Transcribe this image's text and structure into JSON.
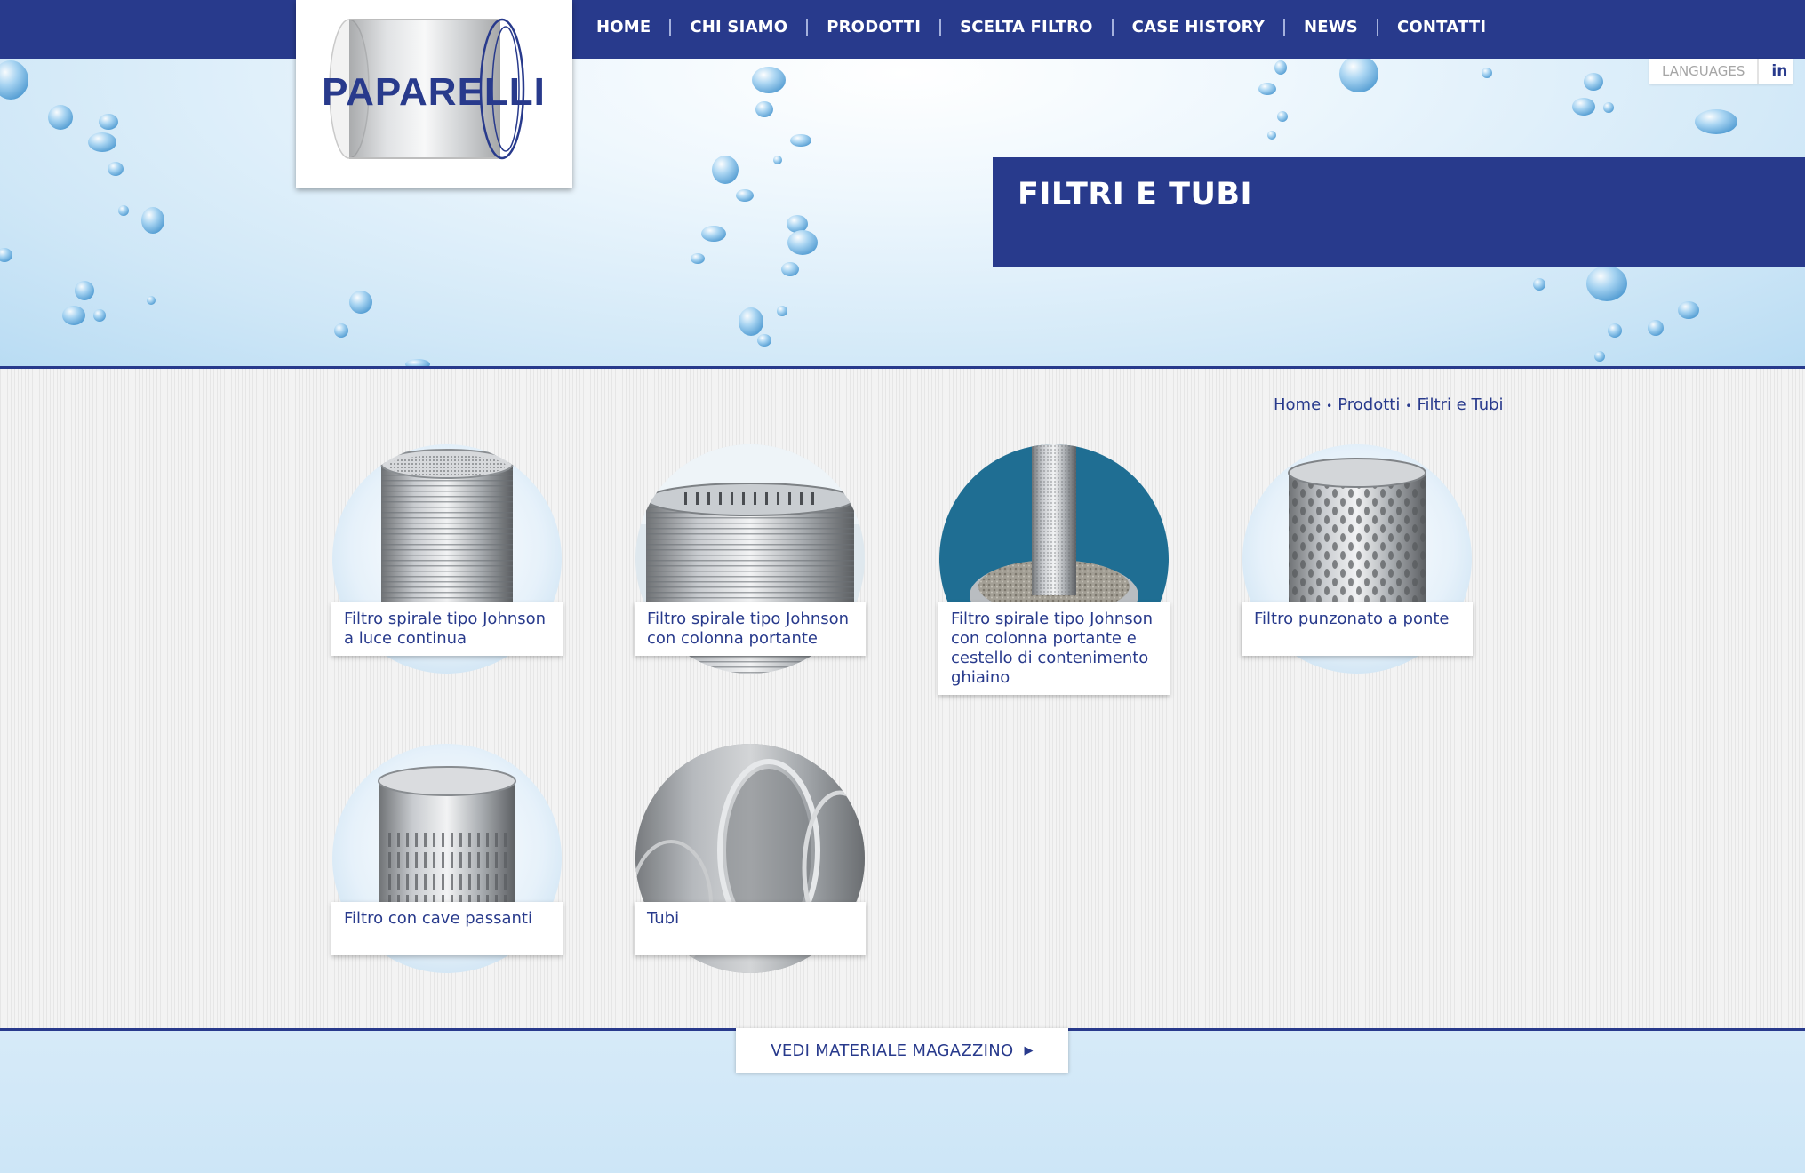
{
  "brand": {
    "name": "PAPARELLI",
    "primary": "#283a8c",
    "accent": "#a4b0dd"
  },
  "nav": {
    "items": [
      {
        "label": "HOME"
      },
      {
        "label": "CHI SIAMO"
      },
      {
        "label": "PRODOTTI"
      },
      {
        "label": "SCELTA FILTRO"
      },
      {
        "label": "CASE HISTORY"
      },
      {
        "label": "NEWS"
      },
      {
        "label": "CONTATTI"
      }
    ]
  },
  "lang_bar": {
    "languages_label": "LANGUAGES",
    "linkedin_label": "in",
    "linkedin_icon": "linkedin-icon"
  },
  "header": {
    "title": "FILTRI E TUBI"
  },
  "breadcrumb": {
    "home": "Home",
    "products": "Prodotti",
    "current": "Filtri e Tubi",
    "separator": "•"
  },
  "products": [
    {
      "label": "Filtro spirale tipo Johnson a luce continua",
      "icon": "wire-wrap-screen-image"
    },
    {
      "label": "Filtro spirale tipo Johnson con colonna portante",
      "icon": "wire-wrap-column-image"
    },
    {
      "label": "Filtro spirale tipo Johnson con colonna portante e cestello di contenimento ghiaino",
      "icon": "gravel-pack-screen-image"
    },
    {
      "label": "Filtro punzonato a ponte",
      "icon": "bridge-slot-screen-image"
    },
    {
      "label": "Filtro con cave passanti",
      "icon": "slotted-screen-image"
    },
    {
      "label": "Tubi",
      "icon": "pipes-image"
    }
  ],
  "cta": {
    "label": "VEDI MATERIALE MAGAZZINO",
    "icon": "caret-right-icon"
  }
}
